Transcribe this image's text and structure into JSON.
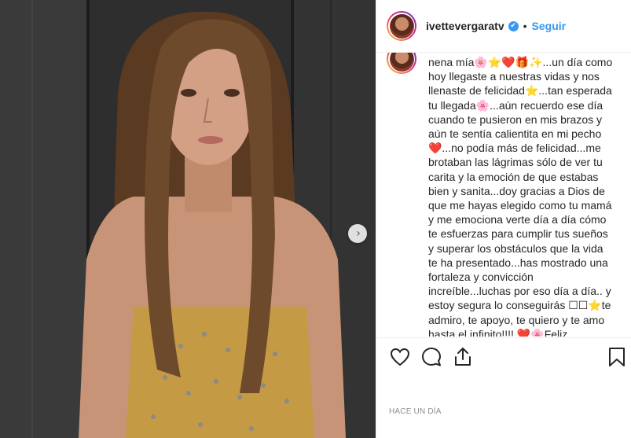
{
  "post": {
    "username": "ivettevergaratv",
    "dot": "•",
    "follow_label": "Seguir",
    "timestamp": "HACE UN DÍA",
    "caption": "nena mía🌸⭐❤️🎁✨...un día como hoy llegaste a nuestras vidas y nos llenaste de felicidad⭐...tan esperada tu llegada🌸...aún recuerdo ese día cuando te pusieron en mis brazos y aún te sentía calientita en mi pecho ❤️...no podía más de felicidad...me brotaban las lágrimas sólo de ver tu carita y la emoción de que estabas bien y sanita...doy gracias a Dios de que me hayas elegido como tu mamá y me emociona verte día a día cómo te esfuerzas para cumplir tus sueños y superar los obstáculos que la vida te ha presentado...has mostrado una fortaleza y convicción increíble...luchas por eso día a día.. y estoy segura lo conseguirás ☐☐⭐te admiro, te apoyo, te quiero y te amo hasta el infinito!!!! ❤️🌸Feliz cumpleaños mi amada"
  },
  "icons": {
    "verified": "✔",
    "next": "›"
  },
  "colors": {
    "link": "#3897f0",
    "text": "#262626",
    "muted": "#8e8e8e"
  }
}
